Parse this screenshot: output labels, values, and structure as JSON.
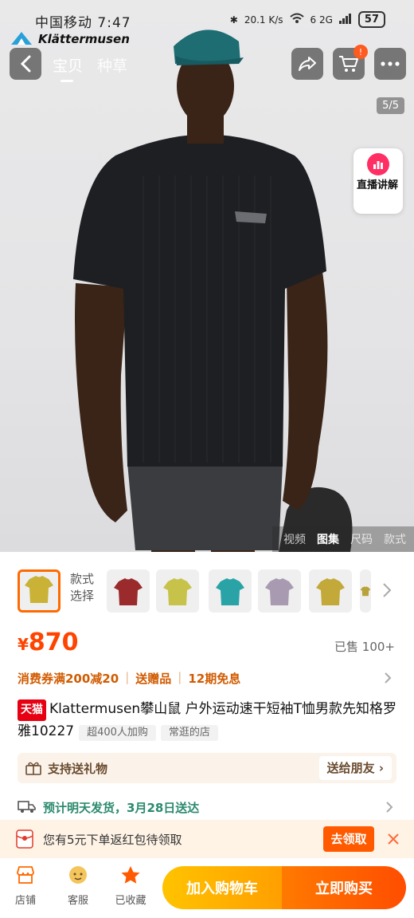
{
  "status_bar": {
    "carrier_time": "中国移动 7:47",
    "net_speed": "20.1 K/s",
    "signal": "6 2G",
    "battery": "57"
  },
  "brand": {
    "name": "Klättermusen"
  },
  "nav": {
    "tabs": [
      {
        "label": "宝贝",
        "active": true
      },
      {
        "label": "种草",
        "active": false
      }
    ],
    "cart_badge": "!"
  },
  "gallery": {
    "pager": "5/5",
    "live_label": "直播讲解",
    "media_tabs": [
      {
        "label": "视频",
        "selected": false
      },
      {
        "label": "图集",
        "selected": true
      },
      {
        "label": "尺码",
        "selected": false
      },
      {
        "label": "款式",
        "selected": false
      }
    ]
  },
  "variants": {
    "label": "款式选择",
    "colors": [
      "#c9b236",
      "#9a2a2b",
      "#c7c24a",
      "#2aa3a6",
      "#a89ab0",
      "#c2a93a",
      "#b8a23a"
    ]
  },
  "product": {
    "price_symbol": "¥",
    "price": "870",
    "sold": "已售 100+",
    "promos": [
      "消费券满200减20",
      "送赠品",
      "12期免息"
    ],
    "badge": "天猫",
    "title": "Klattermusen攀山鼠 户外运动速干短袖T恤男款先知格罗雅10227",
    "chips": [
      "超400人加购",
      "常逛的店"
    ]
  },
  "gift": {
    "label": "支持送礼物",
    "button": "送给朋友"
  },
  "shipping": {
    "text": "预计明天发货，3月28日送达"
  },
  "coupon": {
    "text": "您有5元下单返红包待领取",
    "claim": "去领取"
  },
  "bottom_bar": {
    "shop": "店铺",
    "service": "客服",
    "favorite": "已收藏",
    "add_to_cart": "加入购物车",
    "buy_now": "立即购买"
  },
  "colors": {
    "accent": "#ff5a00",
    "price": "#ff4400",
    "tmall_red": "#e60012"
  }
}
